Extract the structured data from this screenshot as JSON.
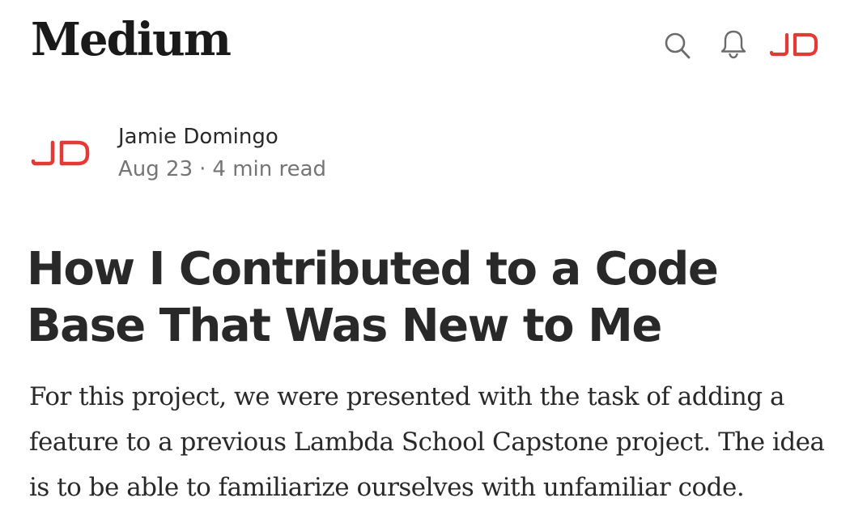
{
  "header": {
    "logo_text": "Medium",
    "search_icon": "search-icon",
    "notifications_icon": "bell-icon",
    "user_avatar_text": "JD"
  },
  "author": {
    "avatar_text": "JD",
    "name": "Jamie Domingo",
    "date": "Aug 23",
    "separator": "·",
    "read_time": "4 min read"
  },
  "article": {
    "title": "How I Contributed to a Code Base That Was New to Me",
    "subtitle": "For this project, we were presented with the task of adding a feature to a previous Lambda School Capstone project. The idea is to be able to familiarize ourselves with unfamiliar code."
  },
  "colors": {
    "brand_red": "#e53935",
    "text": "#292929",
    "muted": "#757575",
    "icon_gray": "#6b6b6b"
  }
}
